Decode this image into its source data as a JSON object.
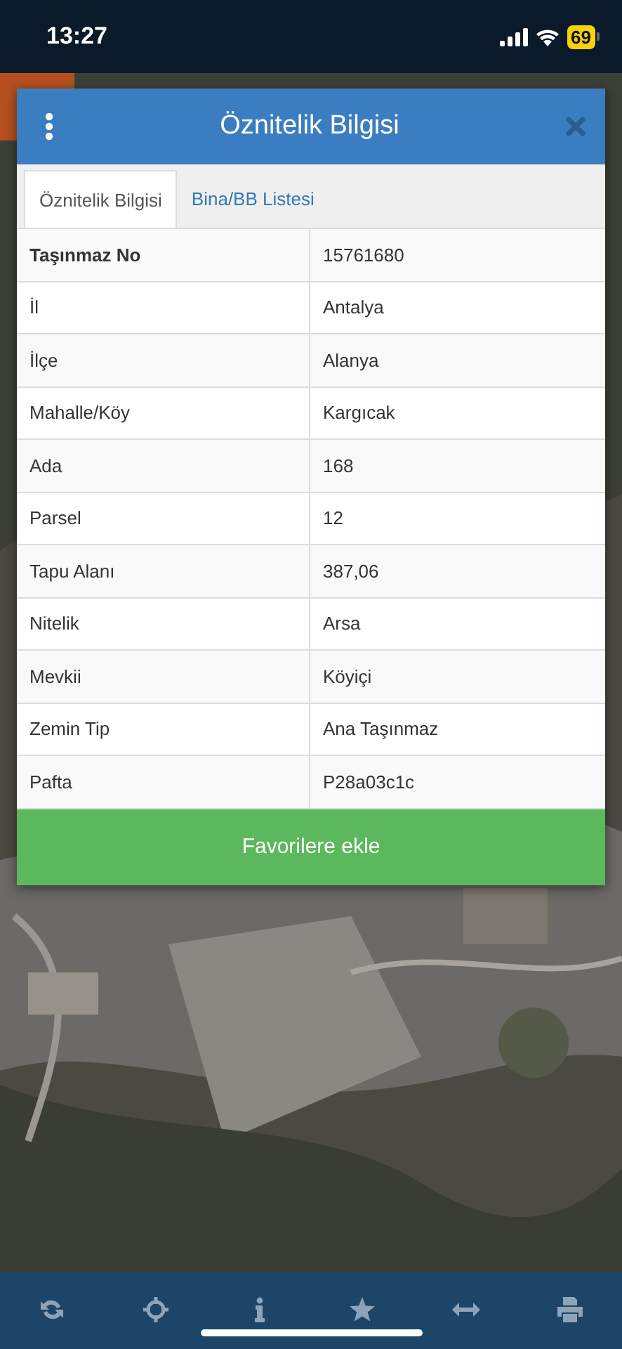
{
  "status_bar": {
    "time": "13:27",
    "battery": "69"
  },
  "dialog": {
    "title": "Öznitelik Bilgisi",
    "tabs": [
      {
        "label": "Öznitelik Bilgisi",
        "selected": true
      },
      {
        "label": "Bina/BB Listesi",
        "selected": false
      }
    ],
    "rows": [
      {
        "label": "Taşınmaz No",
        "value": "15761680",
        "bold": true
      },
      {
        "label": "İl",
        "value": "Antalya",
        "bold": false
      },
      {
        "label": "İlçe",
        "value": "Alanya",
        "bold": false
      },
      {
        "label": "Mahalle/Köy",
        "value": "Kargıcak",
        "bold": false
      },
      {
        "label": "Ada",
        "value": "168",
        "bold": false
      },
      {
        "label": "Parsel",
        "value": "12",
        "bold": false
      },
      {
        "label": "Tapu Alanı",
        "value": "387,06",
        "bold": false
      },
      {
        "label": "Nitelik",
        "value": "Arsa",
        "bold": false
      },
      {
        "label": "Mevkii",
        "value": "Köyiçi",
        "bold": false
      },
      {
        "label": "Zemin Tip",
        "value": "Ana Taşınmaz",
        "bold": false
      },
      {
        "label": "Pafta",
        "value": "P28a03c1c",
        "bold": false
      }
    ],
    "button": "Favorilere ekle"
  }
}
